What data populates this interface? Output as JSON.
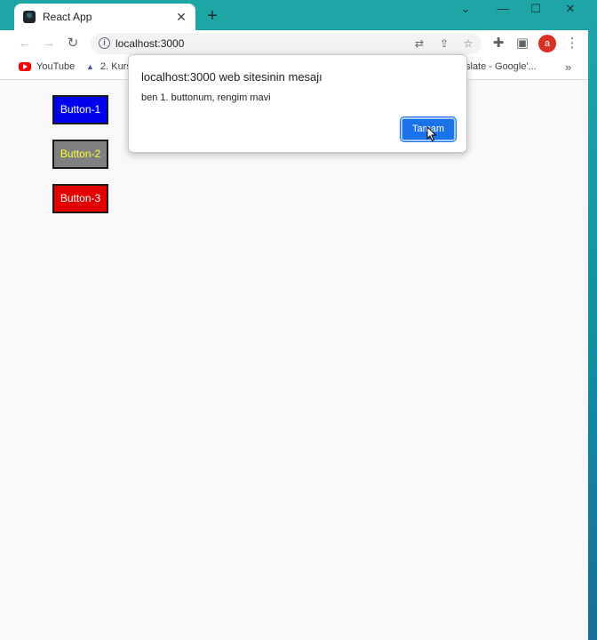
{
  "browser": {
    "tab_title": "React App",
    "tab_close": "✕",
    "new_tab": "+",
    "window_controls": {
      "minimize": "—",
      "maximize": "☐",
      "close": "✕",
      "dropdown": "⌄"
    },
    "url": "localhost:3000",
    "avatar_letter": "a",
    "bookmarks": [
      {
        "label": "YouTube",
        "icon": "youtube-icon"
      },
      {
        "label": "2. Kurs",
        "icon": "bookmark-icon"
      },
      {
        "label": "slate - Google'...",
        "icon": "none"
      }
    ],
    "bookmarks_more": "»"
  },
  "page": {
    "buttons": [
      {
        "label": "Button-1",
        "bg": "#0000ee",
        "color": "#ffffff"
      },
      {
        "label": "Button-2",
        "bg": "#808080",
        "color": "#ffff33"
      },
      {
        "label": "Button-3",
        "bg": "#e30000",
        "color": "#ffffff"
      }
    ]
  },
  "dialog": {
    "title": "localhost:3000 web sitesinin mesajı",
    "message": "ben 1. buttonum, rengim mavi",
    "ok_label": "Tamam"
  },
  "colors": {
    "titlebar": "#1ea6a6",
    "accent": "#1a73e8"
  }
}
